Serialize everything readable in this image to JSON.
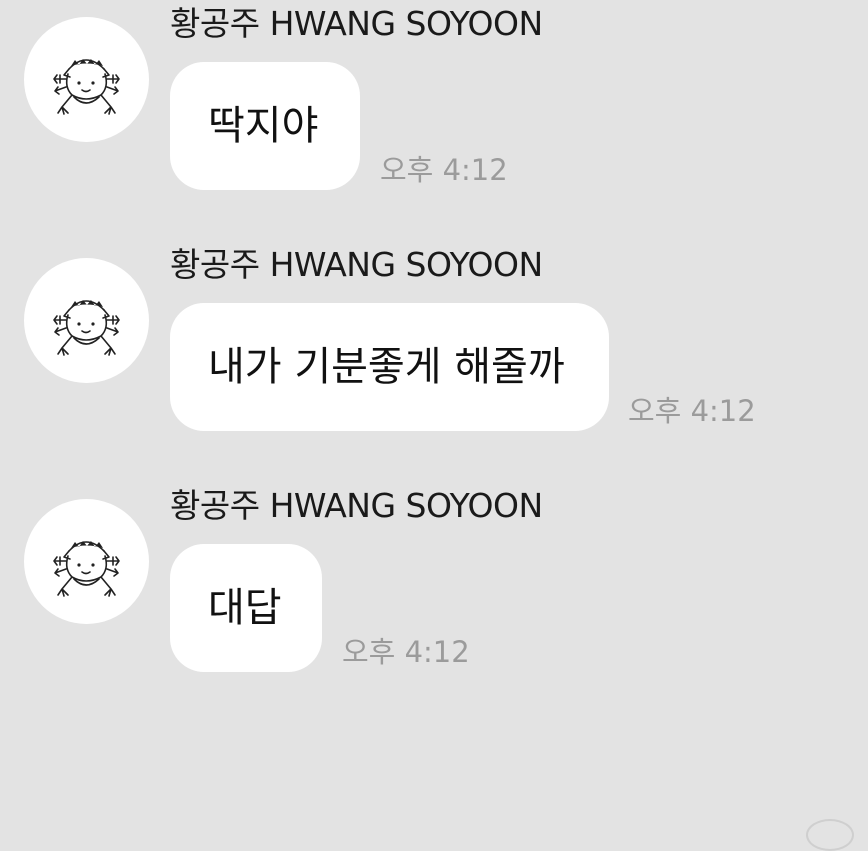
{
  "messages": [
    {
      "sender": "황공주 HWANG SOYOON",
      "text": "딱지야",
      "time": "오후 4:12",
      "avatar_icon": "frog-cartoon-avatar"
    },
    {
      "sender": "황공주 HWANG SOYOON",
      "text": "내가 기분좋게 해줄까",
      "time": "오후 4:12",
      "avatar_icon": "frog-cartoon-avatar"
    },
    {
      "sender": "황공주 HWANG SOYOON",
      "text": "대답",
      "time": "오후 4:12",
      "avatar_icon": "frog-cartoon-avatar"
    }
  ],
  "colors": {
    "background": "#e3e3e3",
    "bubble": "#ffffff",
    "text": "#111111",
    "timestamp": "#9b9b9b"
  }
}
